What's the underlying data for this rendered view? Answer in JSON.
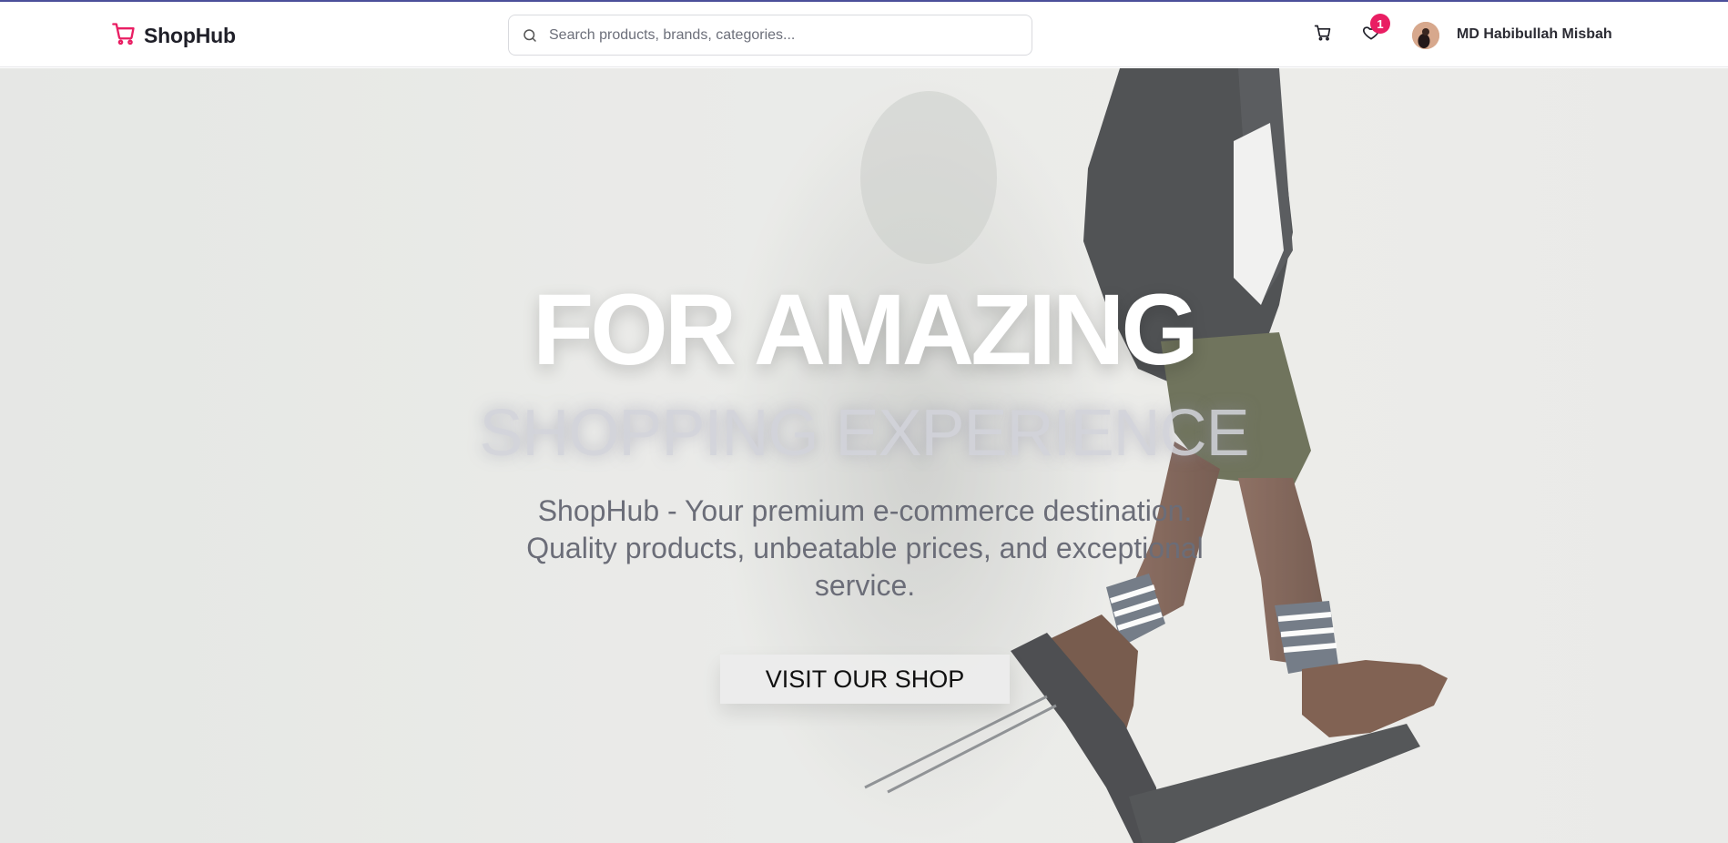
{
  "colors": {
    "accent": "#e91e63",
    "top_line": "#4b4f9a",
    "text_dark": "#1f1f28",
    "text_muted": "#6b6d78"
  },
  "navbar": {
    "brand": {
      "name": "ShopHub",
      "icon": "shopping-cart-icon"
    },
    "search": {
      "placeholder": "Search products, brands, categories...",
      "value": "",
      "icon": "search-icon"
    },
    "cart": {
      "icon": "shopping-cart-icon"
    },
    "wishlist": {
      "icon": "heart-icon",
      "count": "1"
    },
    "user": {
      "name": "MD Habibullah Misbah",
      "avatar": "avatar"
    }
  },
  "hero": {
    "title": "FOR AMAZING",
    "subtitle": "SHOPPING EXPERIENCE",
    "description": "ShopHub - Your premium e-commerce destination. Quality products, unbeatable prices, and exceptional service.",
    "cta_label": "VISIT OUR SHOP",
    "background_image": "man-walking-on-chair-photo"
  }
}
